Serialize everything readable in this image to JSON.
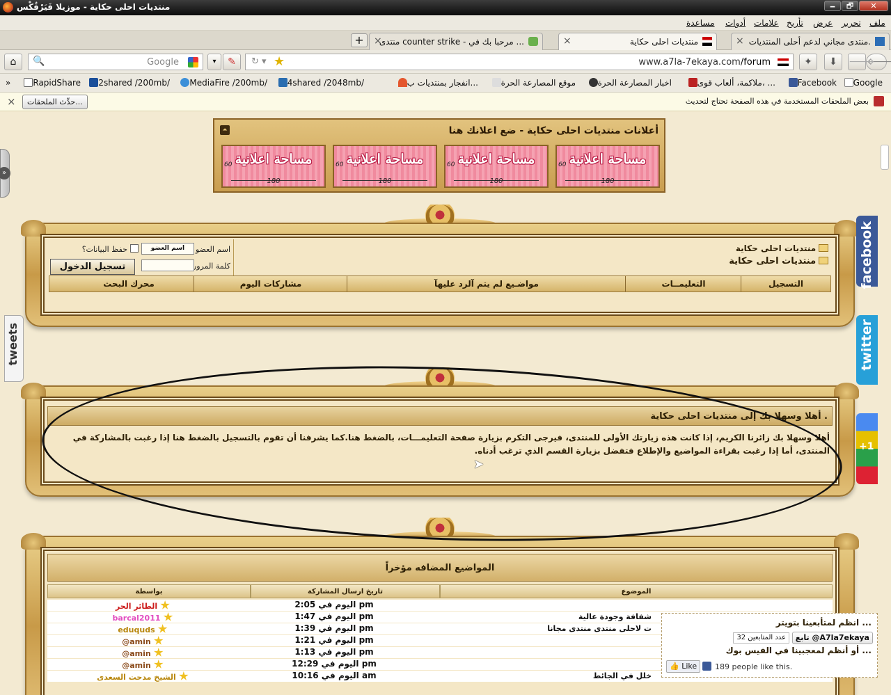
{
  "window": {
    "title": "منتديات احلى حكاية - موزيلا فَيَرْفُكْس",
    "buttons": [
      "🗕",
      "🗗",
      "✕"
    ]
  },
  "menu": [
    "ملف",
    "تحرير",
    "عرض",
    "تأريخ",
    "علامات",
    "أدوات",
    "مساعدة"
  ],
  "tabs": [
    {
      "label": "منتدى مجاني لدعم أحلى المنتديات.",
      "active": false
    },
    {
      "label": "منتديات احلى حكاية",
      "active": true
    },
    {
      "label": "منتدى counter strike - مرحبا بك في ...",
      "active": false
    }
  ],
  "toolbar": {
    "url_domain": "www.a7la-7ekaya.com",
    "url_path": "/forum",
    "search_placeholder": "Google",
    "back_icon": "back-arrow-icon",
    "forward_icon": "forward-arrow-icon",
    "home_icon": "home-icon"
  },
  "bookmarks": [
    "Google",
    "Facebook",
    "ملاكمة، ألعاب قوى، ...",
    "اخبار المصارعة الحرة",
    "موقع المصارعة الحرة",
    "انفجار بمنتديات ب...",
    "4shared /2048mb/",
    "MediaFire /200mb/",
    "2shared /200mb/",
    "RapidShare",
    "»"
  ],
  "notification": {
    "text": "بعض الملحقات المستخدمة في هذه الصفحة تحتاج لتحديث",
    "button": "حدِّث الملحقات...",
    "close": "×"
  },
  "ads": {
    "heading": "أعلانات منتديات احلى حكاية - ضع اعلانك هنا",
    "items": [
      {
        "text": "مساحة اعلانية",
        "w": "180",
        "h": "60"
      },
      {
        "text": "مساحة اعلانية",
        "w": "180",
        "h": "60"
      },
      {
        "text": "مساحة اعلانية",
        "w": "180",
        "h": "60"
      },
      {
        "text": "مساحة اعلانية",
        "w": "180",
        "h": "60"
      }
    ]
  },
  "header": {
    "breadcrumb_small": "منتديات احلى حكاية",
    "breadcrumb_main": "منتديات احلى حكاية",
    "username_label": "اسم العضو",
    "username_value": "اسم العضو",
    "password_label": "كلمة المرور",
    "remember_label": "حفظ البيانات؟",
    "login_button": "تسجيل الدخول",
    "nav": [
      "التسجيل",
      "التعليمــات",
      "مواضـيع لم يتم آلرد عليهآ",
      "مشاركات اليوم",
      "محرك البحث"
    ]
  },
  "welcome": {
    "title": "أهلا وسهلا بك إلى منتديات احلى حكاية .",
    "body": "أهلا وسهلا بك زائرنا الكريم، إذا كانت هذه زيارتك الأولى للمنتدى، فيرجى التكرم بزيارة صفحة التعليمـــات، بالضغط هنا.كما يشرفنا أن تقوم بالتسجيل بالضغط هنا إذا رغبت بالمشاركة في المنتدى، أما إذا رغبت بقراءة المواضيع والإطلاع فتفضل بزيارة القسم الذي ترغب أدناه."
  },
  "recent": {
    "title": "المواضيع المضافه مؤخراً",
    "columns": [
      "الموضوع",
      "تاريخ ارسال المشاركة",
      "بواسطة"
    ],
    "rows": [
      {
        "topic": "",
        "date": "اليوم في 2:05 pm",
        "by": "الطائر الحر",
        "color": "#cc1a1a"
      },
      {
        "topic": "شفافة وجودة عالية",
        "date": "اليوم في 1:47 pm",
        "by": "barcal2011",
        "color": "#e24ec0"
      },
      {
        "topic": "ت لاحلى منتدى منتدى مجانا",
        "date": "اليوم في 1:39 pm",
        "by": "eduquds",
        "color": "#b8860b"
      },
      {
        "topic": "",
        "date": "اليوم في 1:21 pm",
        "by": "@amin",
        "color": "#8a4a1a"
      },
      {
        "topic": "",
        "date": "اليوم في 1:13 pm",
        "by": "@amin",
        "color": "#8a4a1a"
      },
      {
        "topic": "",
        "date": "اليوم في 12:29 pm",
        "by": "@amin",
        "color": "#8a4a1a"
      },
      {
        "topic": "خلل في الجائط",
        "date": "اليوم في 10:16 am",
        "by": "الشيخ مدحت السعدى",
        "color": "#b8860b"
      }
    ]
  },
  "social": {
    "facebook": "facebook",
    "twitter": "twitter",
    "gplus": "+1",
    "tweets": "tweets"
  },
  "popup": {
    "twitter_line": "انظم لمتأبعينا بتويتر ...",
    "follow_button": "تابع @A7la7ekaya",
    "followers": "عدد المتابعين 32",
    "fb_line": "أو أنظم لمعجبينا في الفيس بوك ...",
    "like_button": "Like",
    "like_text": "189 people like this."
  }
}
